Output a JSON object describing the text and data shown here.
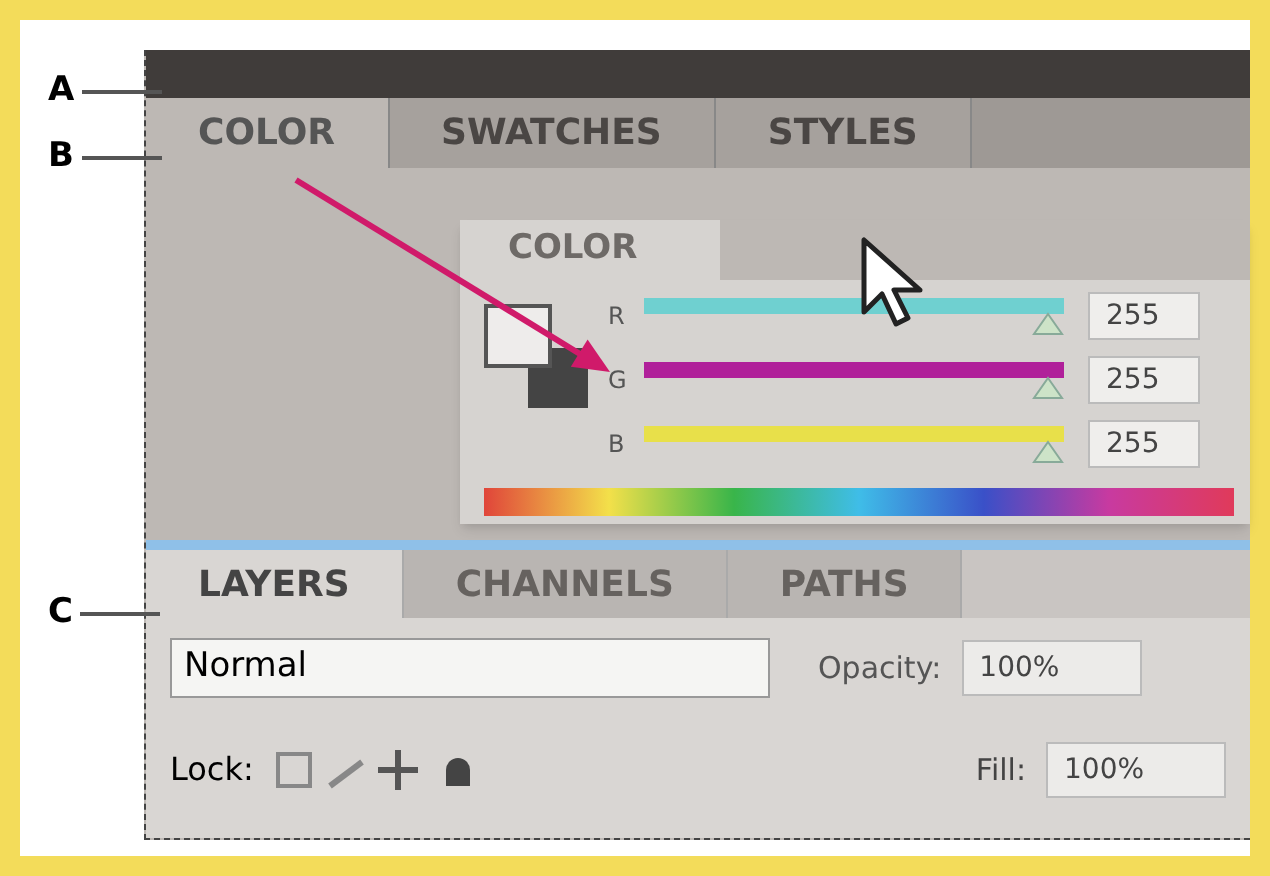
{
  "callouts": [
    {
      "label": "A"
    },
    {
      "label": "B"
    },
    {
      "label": "C"
    }
  ],
  "top_panel": {
    "tabs": [
      {
        "label": "COLOR",
        "selected": true
      },
      {
        "label": "SWATCHES",
        "selected": false
      },
      {
        "label": "STYLES",
        "selected": false
      }
    ]
  },
  "floating_panel": {
    "tab": "COLOR",
    "sliders": [
      {
        "label": "R",
        "color": "#6fd0d0",
        "level": 1,
        "value": "255"
      },
      {
        "label": "G",
        "color": "#b0209a",
        "level": 1,
        "value": "255"
      },
      {
        "label": "B",
        "color": "#e8e04a",
        "level": 1,
        "value": "255"
      }
    ]
  },
  "bottom_panel": {
    "tabs": [
      {
        "label": "LAYERS",
        "selected": true
      },
      {
        "label": "CHANNELS",
        "selected": false
      },
      {
        "label": "PATHS",
        "selected": false
      }
    ],
    "blend_mode": "Normal",
    "opacity_label": "Opacity:",
    "opacity": "100%",
    "lock_label": "Lock:",
    "fill_label": "Fill:",
    "fill": "100%"
  }
}
